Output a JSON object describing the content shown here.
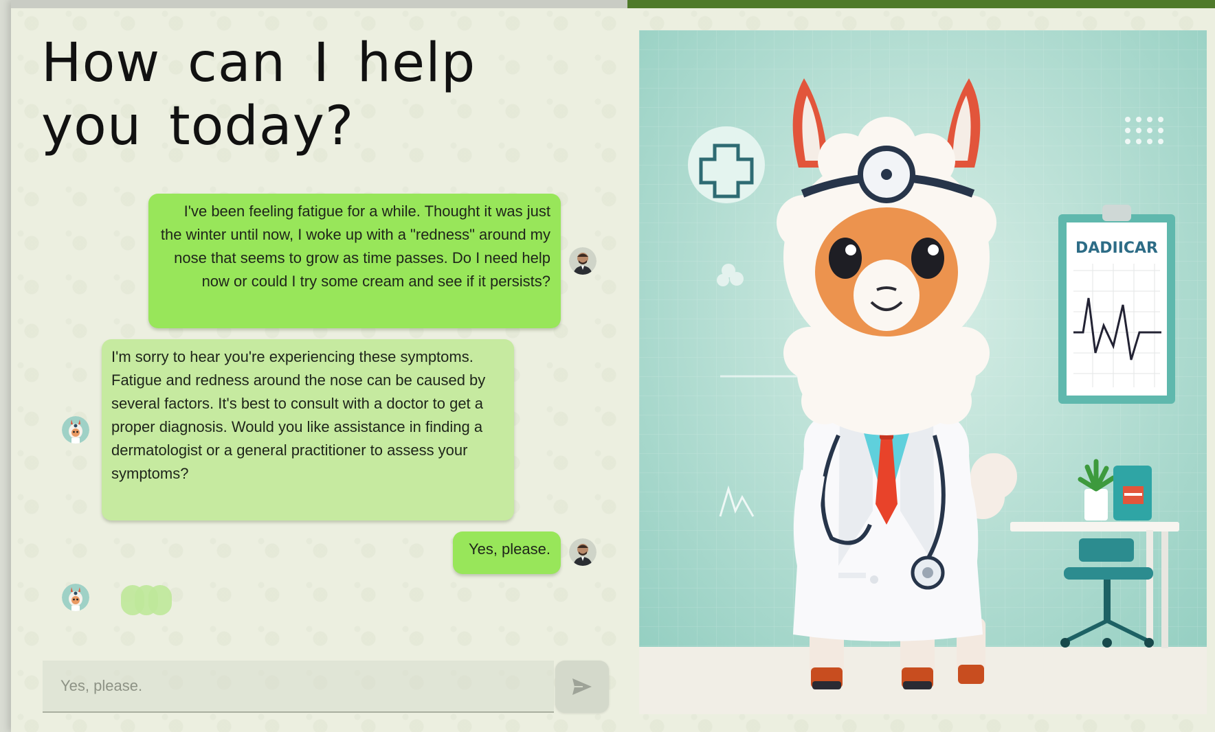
{
  "page": {
    "title": "How can I help you today?"
  },
  "conversation": {
    "messages": [
      {
        "role": "user",
        "text": "I've been feeling fatigue for a while. Thought it was just the winter until now, I woke up with a \"redness\" around my nose that seems to grow as time passes. Do I need help now or could I try some cream and see if it persists?"
      },
      {
        "role": "assistant",
        "text": "I'm sorry to hear you're experiencing these symptoms. Fatigue and redness around the nose can be caused by several factors. It's best to consult with a doctor to get a proper diagnosis. Would you like assistance in finding a dermatologist or a general practitioner to assess your symptoms?"
      },
      {
        "role": "user",
        "text": "Yes, please."
      }
    ],
    "assistant_typing": true
  },
  "composer": {
    "placeholder": "Yes, please.",
    "send_icon": "send-arrow-icon"
  },
  "illustration": {
    "clipboard_text": "DADIICAR",
    "subject": "llama-doctor"
  },
  "colors": {
    "user_bubble": "#98e65a",
    "assistant_bubble": "#c6eaa0",
    "accent_bar": "#4f7a2a",
    "background": "#ecefe0"
  }
}
